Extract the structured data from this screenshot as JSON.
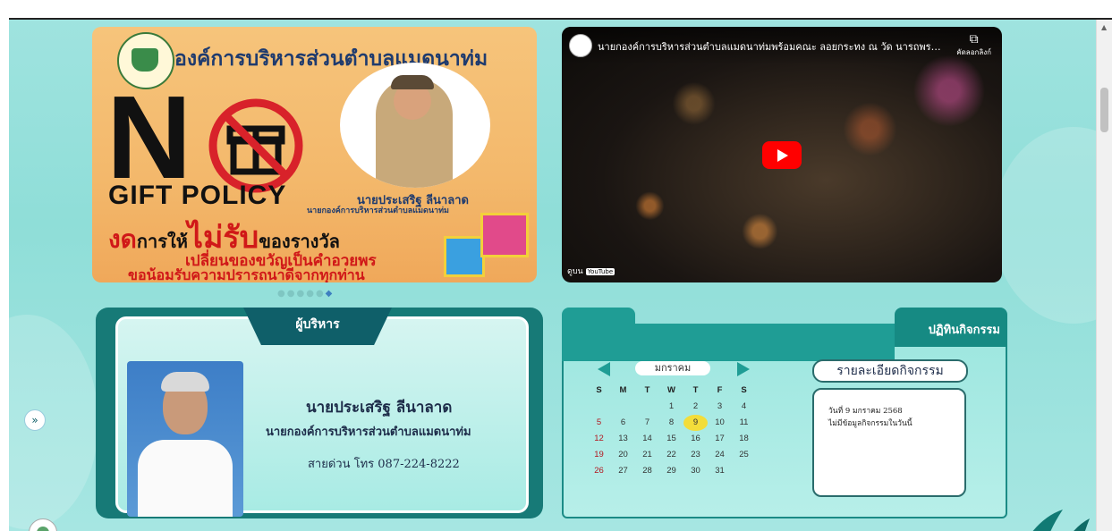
{
  "banner": {
    "org_name": "องค์การบริหารส่วนตำบลแมดนาท่ม",
    "big_letter": "N",
    "policy": "GIFT POLICY",
    "headline_red": "งด",
    "headline_1": "การให้",
    "headline_red2": "ไม่รับ",
    "headline_2": "ของรางวัล",
    "line2": "เปลี่ยนของขวัญเป็นคำอวยพร",
    "line3": "ขอน้อมรับความปรารถนาดีจากทุกท่าน",
    "person_name": "นายประเสริฐ ลีนาลาด",
    "person_title": "นายกองค์การบริหารส่วนตำบลแมดนาท่ม"
  },
  "carousel": {
    "dots": [
      "●",
      "●",
      "●",
      "●",
      "●",
      "◆"
    ]
  },
  "video": {
    "title": "นายกองค์การบริหารส่วนตำบลแมดนาท่มพร้อมคณะ ลอยกระทง ณ วัด นารถพรหมว...",
    "copy_label": "คัดลอกลิงก์",
    "copy_icon": "⧉",
    "watch_on": "ดูบน",
    "youtube": "YouTube"
  },
  "admin": {
    "tab": "ผู้บริหาร",
    "name": "นายประเสริฐ ลีนาลาด",
    "position": "นายกองค์การบริหารส่วนตำบลแมดนาท่ม",
    "phone": "สายด่วน โทร 087-224-8222"
  },
  "calendar": {
    "tab": "ปฏิทินกิจกรรม",
    "month": "มกราคม",
    "weekdays": [
      "S",
      "M",
      "T",
      "W",
      "T",
      "F",
      "S"
    ],
    "weeks": [
      [
        "",
        "",
        "",
        "1",
        "2",
        "3",
        "4"
      ],
      [
        "5",
        "6",
        "7",
        "8",
        "9",
        "10",
        "11"
      ],
      [
        "12",
        "13",
        "14",
        "15",
        "16",
        "17",
        "18"
      ],
      [
        "19",
        "20",
        "21",
        "22",
        "23",
        "24",
        "25"
      ],
      [
        "26",
        "27",
        "28",
        "29",
        "30",
        "31",
        ""
      ]
    ],
    "today": "9",
    "detail_button": "รายละเอียดกิจกรรม",
    "detail_date": "วันที่ 9 มกราคม 2568",
    "detail_text": "ไม่มีข้อมูลกิจกรรมในวันนี้"
  },
  "side_button": "»"
}
